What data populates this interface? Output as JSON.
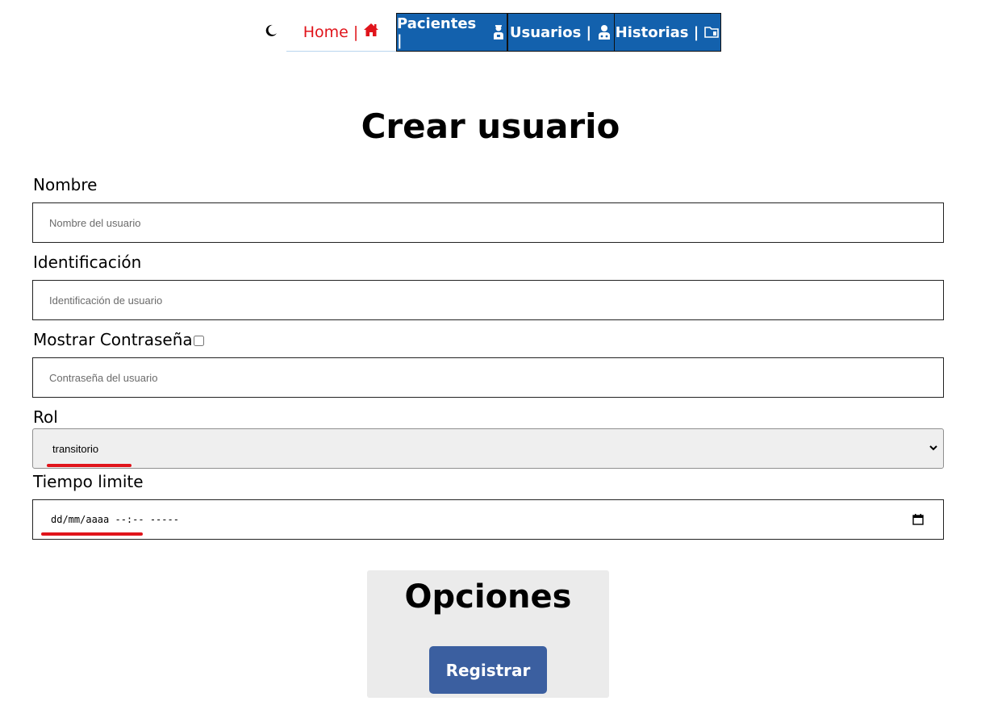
{
  "nav": {
    "theme_icon": "moon-icon",
    "home": {
      "label": "Home |",
      "icon": "home-icon",
      "color": "#e0141b"
    },
    "items": [
      {
        "label": "Pacientes |",
        "icon": "patient-icon"
      },
      {
        "label": "Usuarios |",
        "icon": "doctor-user-icon"
      },
      {
        "label": "Historias |",
        "icon": "folder-icon"
      }
    ],
    "accent": "#1361ad"
  },
  "page": {
    "title": "Crear usuario"
  },
  "form": {
    "nombre": {
      "label": "Nombre",
      "placeholder": "Nombre del usuario",
      "value": ""
    },
    "identificacion": {
      "label": "Identificación",
      "placeholder": "Identificación de usuario",
      "value": ""
    },
    "contrasena": {
      "label": "Mostrar Contraseña",
      "placeholder": "Contraseña del usuario",
      "value": "",
      "show_checked": false
    },
    "rol": {
      "label": "Rol",
      "selected": "transitorio"
    },
    "tiempo": {
      "label": "Tiempo limite",
      "value": "dd/mm/aaaa --:-- -----"
    }
  },
  "options": {
    "title": "Opciones",
    "register_label": "Registrar",
    "button_color": "#3b5fa0"
  }
}
